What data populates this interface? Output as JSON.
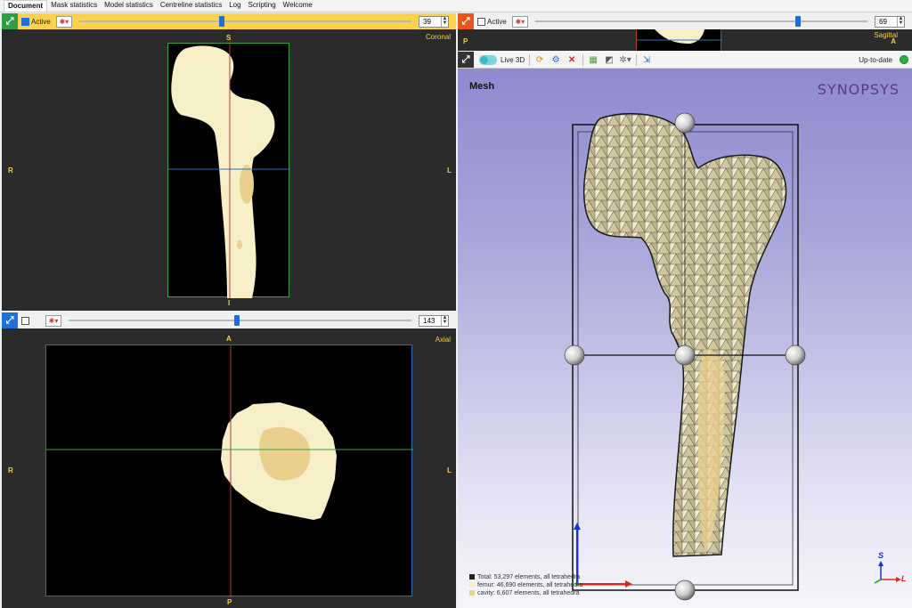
{
  "tabs": [
    "Document",
    "Mask statistics",
    "Model statistics",
    "Centreline statistics",
    "Log",
    "Scripting",
    "Welcome"
  ],
  "coronal": {
    "active_label": "Active",
    "slice": "39",
    "view_name": "Coronal",
    "orient": {
      "top": "S",
      "bottom": "I",
      "left": "R",
      "right": "L"
    },
    "slider_fraction": 0.43
  },
  "axial": {
    "slice": "143",
    "view_name": "Axial",
    "orient": {
      "top": "A",
      "bottom": "P",
      "left": "R",
      "right": "L"
    },
    "slider_fraction": 0.49
  },
  "sagittal": {
    "active_label": "Active",
    "slice": "69",
    "view_name": "Sagittal",
    "orient": {
      "left": "P",
      "right": "A"
    },
    "slider_fraction": 0.79
  },
  "view3d": {
    "live_label": "Live 3D",
    "status": "Up-to-date",
    "title": "Mesh",
    "brand": "SYNOPSYS",
    "legend": [
      {
        "text": "Total: 53,297 elements, all tetrahedra",
        "color": "#222222"
      },
      {
        "text": "femur: 46,690 elements, all tetrahedra",
        "color": "#f6efc8"
      },
      {
        "text": "cavity: 6,607 elements, all tetrahedra",
        "color": "#e9d08f"
      }
    ],
    "axes": {
      "up": "S",
      "right": "L"
    }
  },
  "colors": {
    "bone": "#f6efc8",
    "cavity": "#e9d08f",
    "accent_yellow": "#fcd24c",
    "orient_text": "#f5d13a"
  }
}
